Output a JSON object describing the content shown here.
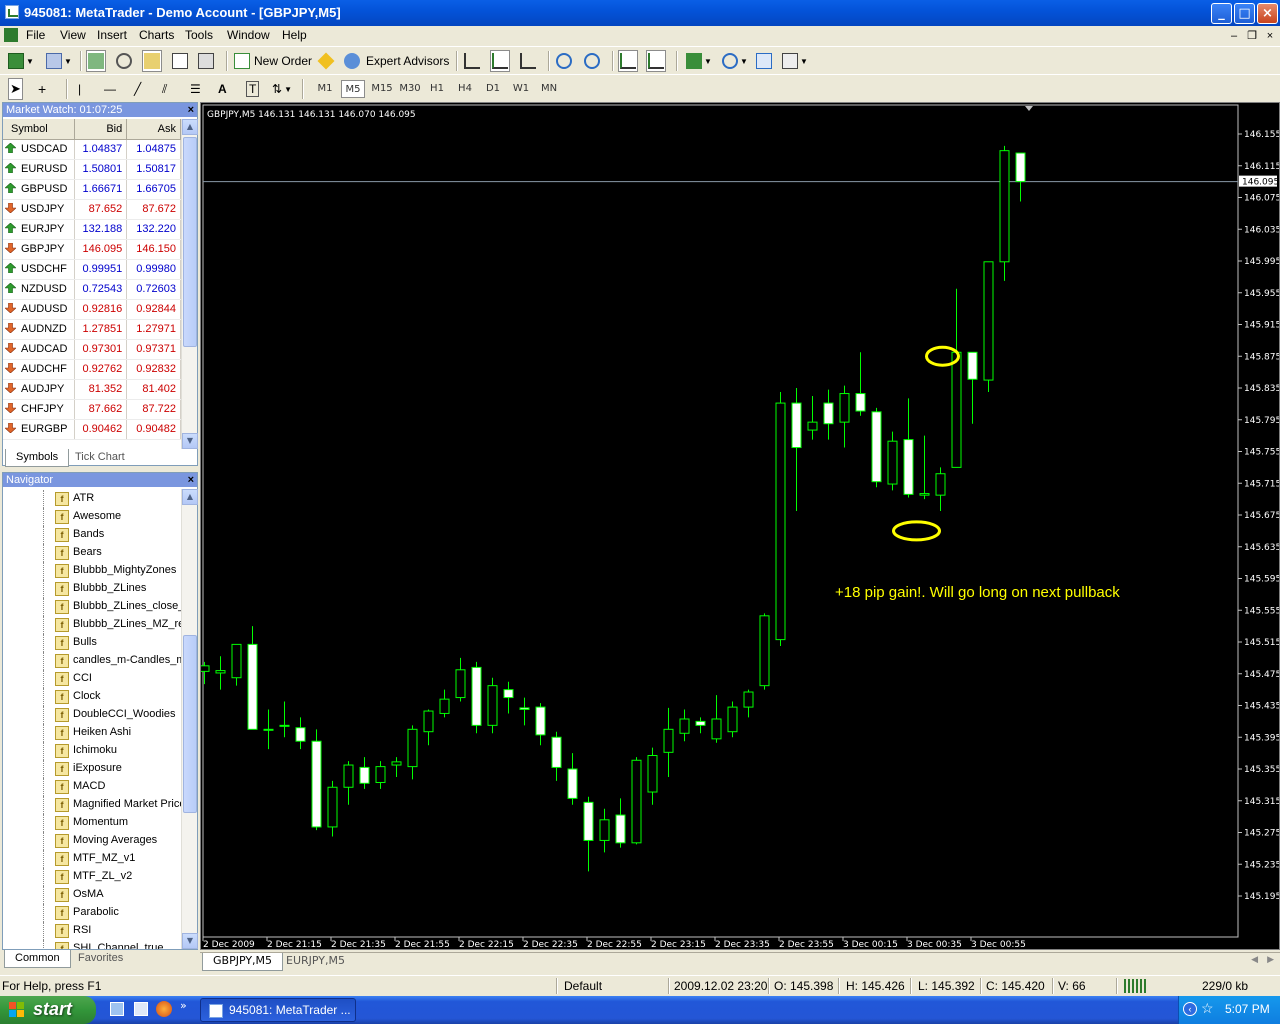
{
  "window": {
    "title": "945081: MetaTrader - Demo Account - [GBPJPY,M5]"
  },
  "menu": [
    "File",
    "View",
    "Insert",
    "Charts",
    "Tools",
    "Window",
    "Help"
  ],
  "toolbar": {
    "new_order": "New Order",
    "expert_advisors": "Expert Advisors"
  },
  "timeframes": [
    "M1",
    "M5",
    "M15",
    "M30",
    "H1",
    "H4",
    "D1",
    "W1",
    "MN"
  ],
  "active_timeframe": "M5",
  "market_watch": {
    "title": "Market Watch: 01:07:25",
    "headers": {
      "symbol": "Symbol",
      "bid": "Bid",
      "ask": "Ask"
    },
    "rows": [
      {
        "symbol": "USDCAD",
        "bid": "1.04837",
        "ask": "1.04875",
        "dir": "up"
      },
      {
        "symbol": "EURUSD",
        "bid": "1.50801",
        "ask": "1.50817",
        "dir": "up"
      },
      {
        "symbol": "GBPUSD",
        "bid": "1.66671",
        "ask": "1.66705",
        "dir": "up"
      },
      {
        "symbol": "USDJPY",
        "bid": "87.652",
        "ask": "87.672",
        "dir": "down"
      },
      {
        "symbol": "EURJPY",
        "bid": "132.188",
        "ask": "132.220",
        "dir": "up"
      },
      {
        "symbol": "GBPJPY",
        "bid": "146.095",
        "ask": "146.150",
        "dir": "down"
      },
      {
        "symbol": "USDCHF",
        "bid": "0.99951",
        "ask": "0.99980",
        "dir": "up"
      },
      {
        "symbol": "NZDUSD",
        "bid": "0.72543",
        "ask": "0.72603",
        "dir": "up"
      },
      {
        "symbol": "AUDUSD",
        "bid": "0.92816",
        "ask": "0.92844",
        "dir": "down"
      },
      {
        "symbol": "AUDNZD",
        "bid": "1.27851",
        "ask": "1.27971",
        "dir": "down"
      },
      {
        "symbol": "AUDCAD",
        "bid": "0.97301",
        "ask": "0.97371",
        "dir": "down"
      },
      {
        "symbol": "AUDCHF",
        "bid": "0.92762",
        "ask": "0.92832",
        "dir": "down"
      },
      {
        "symbol": "AUDJPY",
        "bid": "81.352",
        "ask": "81.402",
        "dir": "down"
      },
      {
        "symbol": "CHFJPY",
        "bid": "87.662",
        "ask": "87.722",
        "dir": "down"
      },
      {
        "symbol": "EURGBP",
        "bid": "0.90462",
        "ask": "0.90482",
        "dir": "down"
      }
    ],
    "tabs": [
      "Symbols",
      "Tick Chart"
    ]
  },
  "navigator": {
    "title": "Navigator",
    "items": [
      "ATR",
      "Awesome",
      "Bands",
      "Bears",
      "Blubbb_MightyZones",
      "Blubbb_ZLines",
      "Blubbb_ZLines_close_",
      "Blubbb_ZLines_MZ_re",
      "Bulls",
      "candles_m-Candles_m",
      "CCI",
      "Clock",
      "DoubleCCI_Woodies",
      "Heiken Ashi",
      "Ichimoku",
      "iExposure",
      "MACD",
      "Magnified Market Price",
      "Momentum",
      "Moving Averages",
      "MTF_MZ_v1",
      "MTF_ZL_v2",
      "OsMA",
      "Parabolic",
      "RSI",
      "SHI_Channel_true"
    ],
    "tabs": [
      "Common",
      "Favorites"
    ]
  },
  "chart_tabs": [
    "GBPJPY,M5",
    "EURJPY,M5"
  ],
  "chart_data": {
    "type": "candlestick",
    "info": "GBPJPY,M5  146.131 146.131 146.070 146.095",
    "current_price": "146.095",
    "y_ticks": [
      "146.155",
      "146.115",
      "146.075",
      "146.035",
      "145.995",
      "145.955",
      "145.915",
      "145.875",
      "145.835",
      "145.795",
      "145.755",
      "145.715",
      "145.675",
      "145.635",
      "145.595",
      "145.555",
      "145.515",
      "145.475",
      "145.435",
      "145.395",
      "145.355",
      "145.315",
      "145.275",
      "145.235",
      "145.195"
    ],
    "x_ticks": [
      "2 Dec 2009",
      "2 Dec 21:15",
      "2 Dec 21:35",
      "2 Dec 21:55",
      "2 Dec 22:15",
      "2 Dec 22:35",
      "2 Dec 22:55",
      "2 Dec 23:15",
      "2 Dec 23:35",
      "2 Dec 23:55",
      "3 Dec 00:15",
      "3 Dec 00:35",
      "3 Dec 00:55"
    ],
    "annotation": "+18 pip gain!. Will go long on next pullback",
    "annotation_color": "#ffff00",
    "candle_color": "#00ff00",
    "bull_fill": "#000000",
    "bear_fill": "#ffffff",
    "candles": [
      {
        "o": 145.478,
        "h": 145.49,
        "l": 145.462,
        "c": 145.485
      },
      {
        "o": 145.476,
        "h": 145.497,
        "l": 145.455,
        "c": 145.479
      },
      {
        "o": 145.47,
        "h": 145.496,
        "l": 145.46,
        "c": 145.512
      },
      {
        "o": 145.512,
        "h": 145.535,
        "l": 145.41,
        "c": 145.405
      },
      {
        "o": 145.405,
        "h": 145.43,
        "l": 145.38,
        "c": 145.405
      },
      {
        "o": 145.41,
        "h": 145.44,
        "l": 145.395,
        "c": 145.41
      },
      {
        "o": 145.407,
        "h": 145.42,
        "l": 145.38,
        "c": 145.39
      },
      {
        "o": 145.39,
        "h": 145.405,
        "l": 145.278,
        "c": 145.282
      },
      {
        "o": 145.282,
        "h": 145.34,
        "l": 145.27,
        "c": 145.332
      },
      {
        "o": 145.332,
        "h": 145.365,
        "l": 145.31,
        "c": 145.36
      },
      {
        "o": 145.357,
        "h": 145.37,
        "l": 145.33,
        "c": 145.337
      },
      {
        "o": 145.338,
        "h": 145.365,
        "l": 145.33,
        "c": 145.358
      },
      {
        "o": 145.36,
        "h": 145.37,
        "l": 145.345,
        "c": 145.364
      },
      {
        "o": 145.358,
        "h": 145.41,
        "l": 145.342,
        "c": 145.405
      },
      {
        "o": 145.402,
        "h": 145.43,
        "l": 145.385,
        "c": 145.428
      },
      {
        "o": 145.425,
        "h": 145.455,
        "l": 145.42,
        "c": 145.443
      },
      {
        "o": 145.445,
        "h": 145.495,
        "l": 145.44,
        "c": 145.48
      },
      {
        "o": 145.483,
        "h": 145.49,
        "l": 145.4,
        "c": 145.41
      },
      {
        "o": 145.41,
        "h": 145.47,
        "l": 145.4,
        "c": 145.46
      },
      {
        "o": 145.455,
        "h": 145.465,
        "l": 145.425,
        "c": 145.445
      },
      {
        "o": 145.432,
        "h": 145.445,
        "l": 145.41,
        "c": 145.43
      },
      {
        "o": 145.433,
        "h": 145.438,
        "l": 145.385,
        "c": 145.398
      },
      {
        "o": 145.395,
        "h": 145.402,
        "l": 145.34,
        "c": 145.357
      },
      {
        "o": 145.355,
        "h": 145.375,
        "l": 145.31,
        "c": 145.318
      },
      {
        "o": 145.313,
        "h": 145.32,
        "l": 145.226,
        "c": 145.265
      },
      {
        "o": 145.265,
        "h": 145.305,
        "l": 145.25,
        "c": 145.291
      },
      {
        "o": 145.297,
        "h": 145.318,
        "l": 145.256,
        "c": 145.262
      },
      {
        "o": 145.262,
        "h": 145.37,
        "l": 145.26,
        "c": 145.366
      },
      {
        "o": 145.326,
        "h": 145.382,
        "l": 145.31,
        "c": 145.372
      },
      {
        "o": 145.376,
        "h": 145.432,
        "l": 145.345,
        "c": 145.405
      },
      {
        "o": 145.4,
        "h": 145.43,
        "l": 145.39,
        "c": 145.418
      },
      {
        "o": 145.415,
        "h": 145.42,
        "l": 145.4,
        "c": 145.41
      },
      {
        "o": 145.393,
        "h": 145.448,
        "l": 145.388,
        "c": 145.418
      },
      {
        "o": 145.402,
        "h": 145.44,
        "l": 145.395,
        "c": 145.433
      },
      {
        "o": 145.433,
        "h": 145.455,
        "l": 145.42,
        "c": 145.452
      },
      {
        "o": 145.46,
        "h": 145.551,
        "l": 145.455,
        "c": 145.548
      },
      {
        "o": 145.518,
        "h": 145.83,
        "l": 145.51,
        "c": 145.816
      },
      {
        "o": 145.816,
        "h": 145.835,
        "l": 145.68,
        "c": 145.76
      },
      {
        "o": 145.782,
        "h": 145.825,
        "l": 145.77,
        "c": 145.792
      },
      {
        "o": 145.816,
        "h": 145.833,
        "l": 145.77,
        "c": 145.79
      },
      {
        "o": 145.792,
        "h": 145.838,
        "l": 145.76,
        "c": 145.828
      },
      {
        "o": 145.828,
        "h": 145.88,
        "l": 145.8,
        "c": 145.806
      },
      {
        "o": 145.805,
        "h": 145.81,
        "l": 145.71,
        "c": 145.717
      },
      {
        "o": 145.714,
        "h": 145.78,
        "l": 145.706,
        "c": 145.768
      },
      {
        "o": 145.77,
        "h": 145.822,
        "l": 145.697,
        "c": 145.701
      },
      {
        "o": 145.7,
        "h": 145.775,
        "l": 145.695,
        "c": 145.702
      },
      {
        "o": 145.7,
        "h": 145.735,
        "l": 145.68,
        "c": 145.727
      },
      {
        "o": 145.735,
        "h": 145.96,
        "l": 145.735,
        "c": 145.88
      },
      {
        "o": 145.88,
        "h": 145.88,
        "l": 145.79,
        "c": 145.846
      },
      {
        "o": 145.845,
        "h": 145.985,
        "l": 145.83,
        "c": 145.994
      },
      {
        "o": 145.994,
        "h": 146.14,
        "l": 145.97,
        "c": 146.134
      },
      {
        "o": 146.131,
        "h": 146.131,
        "l": 146.07,
        "c": 146.095
      }
    ]
  },
  "status": {
    "help": "For Help, press F1",
    "profile": "Default",
    "datetime": "2009.12.02 23:20",
    "open": "O: 145.398",
    "high": "H: 145.426",
    "low": "L: 145.392",
    "close": "C: 145.420",
    "volume": "V: 66",
    "traffic": "229/0 kb"
  },
  "taskbar": {
    "start": "start",
    "task": "945081: MetaTrader ...",
    "clock": "5:07 PM"
  }
}
